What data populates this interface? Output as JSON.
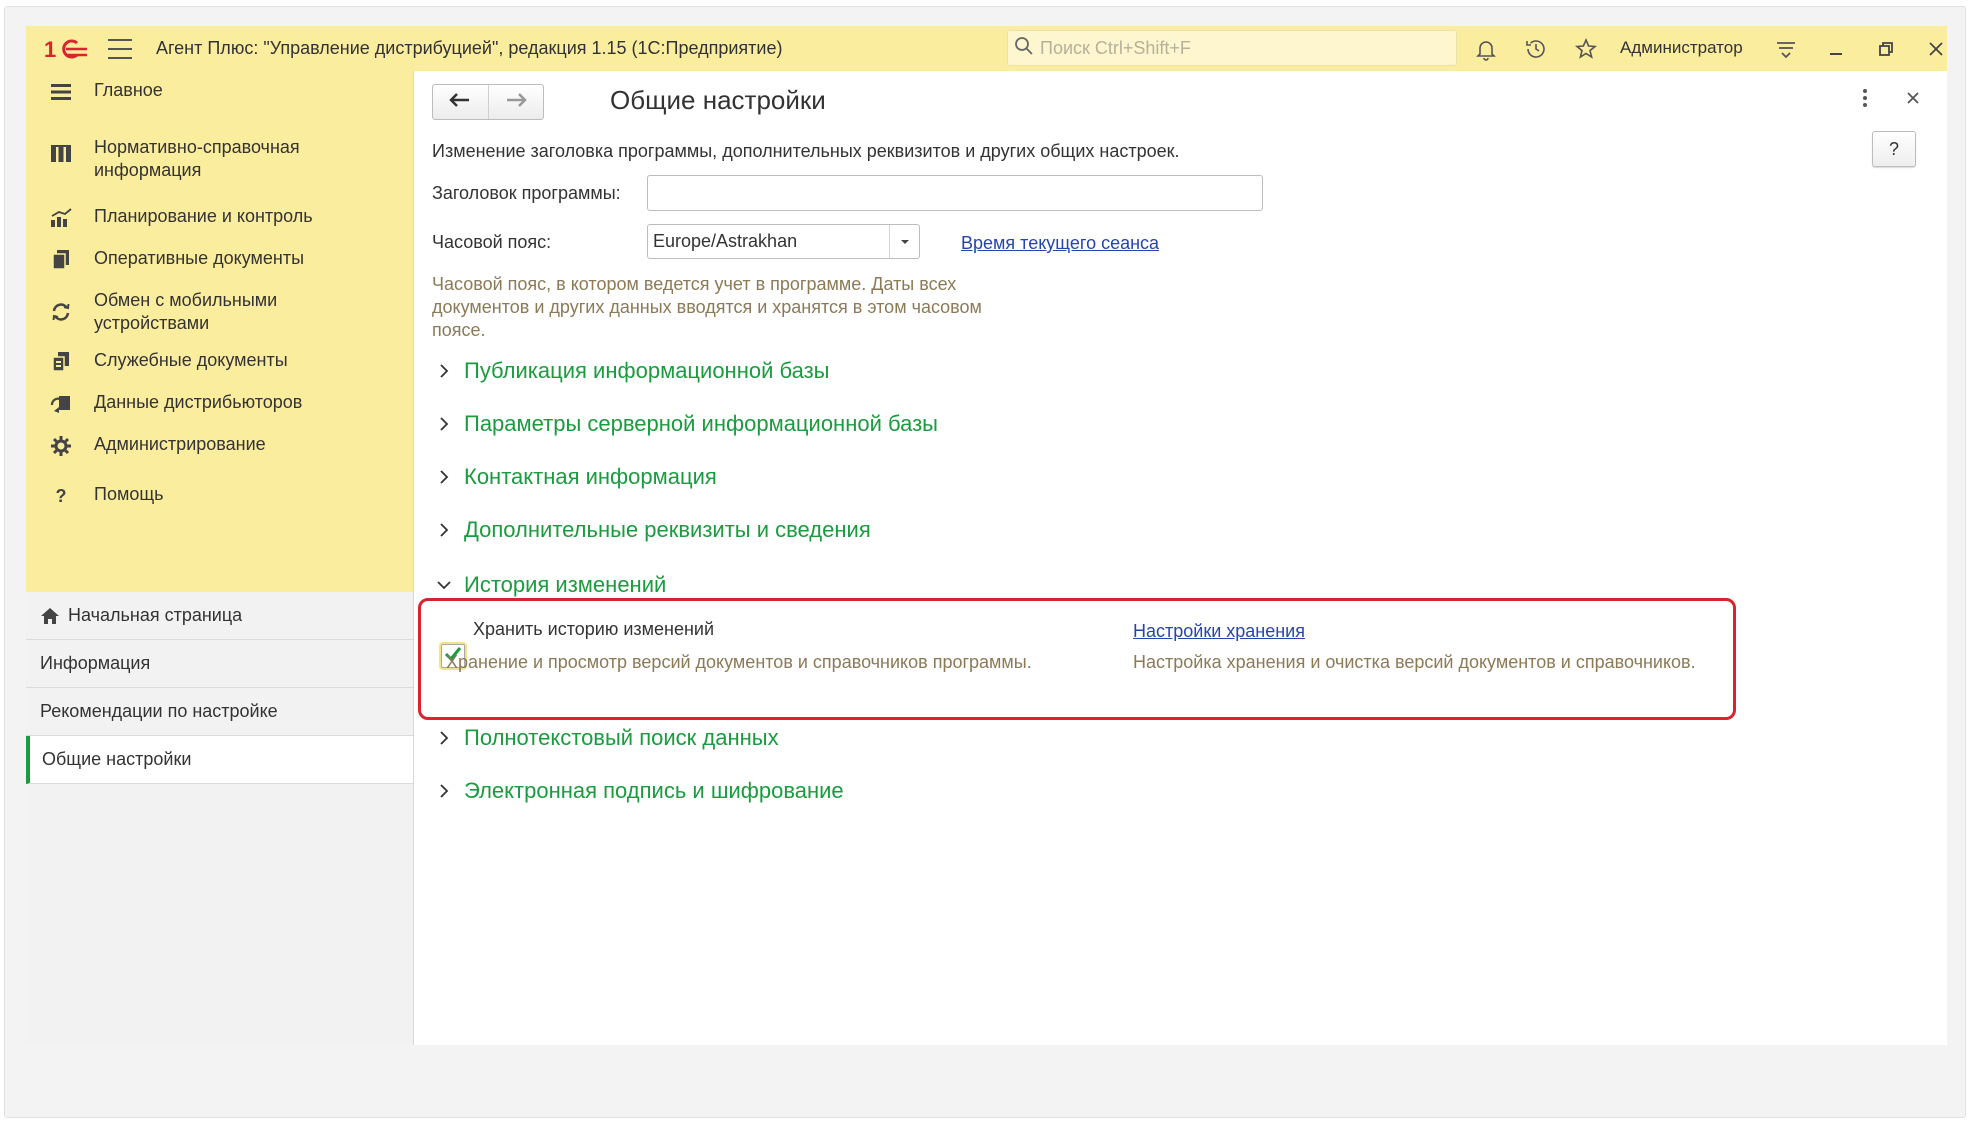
{
  "titlebar": {
    "app_title": "Агент Плюс: \"Управление дистрибуцией\", редакция 1.15  (1С:Предприятие)",
    "search_placeholder": "Поиск Ctrl+Shift+F",
    "user": "Администратор",
    "icons": [
      "1c-logo-icon",
      "menu-icon",
      "search-icon",
      "bell-icon",
      "history-icon",
      "star-icon",
      "settings-lines-icon",
      "minimize-icon",
      "restore-icon",
      "close-icon"
    ]
  },
  "sidebar": {
    "sections": [
      {
        "label": "Главное",
        "icon": "menu-lines-icon"
      },
      {
        "label": "Нормативно-справочная информация",
        "icon": "catalog-icon"
      },
      {
        "label": "Планирование и контроль",
        "icon": "chart-icon"
      },
      {
        "label": "Оперативные документы",
        "icon": "documents-icon"
      },
      {
        "label": "Обмен с мобильными устройствами",
        "icon": "sync-icon"
      },
      {
        "label": "Служебные документы",
        "icon": "service-docs-icon"
      },
      {
        "label": "Данные дистрибьюторов",
        "icon": "distributor-icon"
      },
      {
        "label": "Администрирование",
        "icon": "gear-icon"
      },
      {
        "label": "Помощь",
        "icon": "question-icon"
      }
    ],
    "open_items": [
      {
        "label": "Начальная страница",
        "icon": "home-icon"
      },
      {
        "label": "Информация"
      },
      {
        "label": "Рекомендации по настройке"
      },
      {
        "label": "Общие настройки",
        "active": true
      }
    ]
  },
  "form": {
    "title": "Общие настройки",
    "help_label": "?",
    "description": "Изменение заголовка программы, дополнительных реквизитов и других общих настроек.",
    "program_title_label": "Заголовок программы:",
    "program_title_value": "",
    "timezone_label": "Часовой пояс:",
    "timezone_value": "Europe/Astrakhan",
    "session_time_link": "Время текущего сеанса",
    "timezone_hint": "Часовой пояс, в котором ведется учет в программе. Даты всех документов и других данных вводятся и хранятся в этом часовом поясе.",
    "groups": [
      {
        "label": "Публикация информационной базы",
        "expanded": false
      },
      {
        "label": "Параметры серверной информационной базы",
        "expanded": false
      },
      {
        "label": "Контактная информация",
        "expanded": false
      },
      {
        "label": "Дополнительные реквизиты и сведения",
        "expanded": false
      },
      {
        "label": "История изменений",
        "expanded": true
      },
      {
        "label": "Полнотекстовый поиск данных",
        "expanded": false
      },
      {
        "label": "Электронная подпись и шифрование",
        "expanded": false
      }
    ],
    "history": {
      "checkbox_label": "Хранить историю изменений",
      "checked": true,
      "checkbox_hint": "Хранение и просмотр версий документов и справочников программы.",
      "settings_link": "Настройки хранения",
      "settings_hint": "Настройка хранения и очистка версий документов и справочников."
    }
  },
  "colors": {
    "titlebar_bg": "#fbed9e",
    "group_green": "#1a9c3e",
    "link_blue": "#2545ad",
    "hint_brown": "#8c7a57",
    "highlight_red": "#d9232d"
  }
}
